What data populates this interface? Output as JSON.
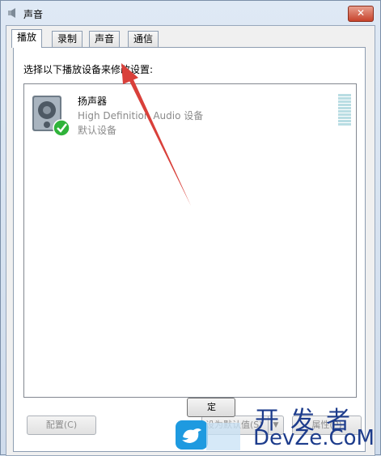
{
  "window": {
    "title": "声音",
    "close_glyph": "✕"
  },
  "tabs": [
    {
      "label": "播放",
      "active": true
    },
    {
      "label": "录制",
      "active": false
    },
    {
      "label": "声音",
      "active": false
    },
    {
      "label": "通信",
      "active": false
    }
  ],
  "instruction": "选择以下播放设备来修改设置:",
  "device": {
    "name": "扬声器",
    "description": "High Definition Audio 设备",
    "status": "默认设备",
    "icon": "speaker-icon",
    "badge": "check-icon"
  },
  "buttons": {
    "configure": "配置(C)",
    "set_default": "设为默认值(S)",
    "properties": "属性(P)",
    "ok_partial": "定"
  },
  "watermark": {
    "chinese": "开发者",
    "english": "DevZe.CoM"
  },
  "colors": {
    "annotation_arrow": "#d9403a",
    "check": "#2fb33a",
    "watermark": "#1d3c8c"
  }
}
